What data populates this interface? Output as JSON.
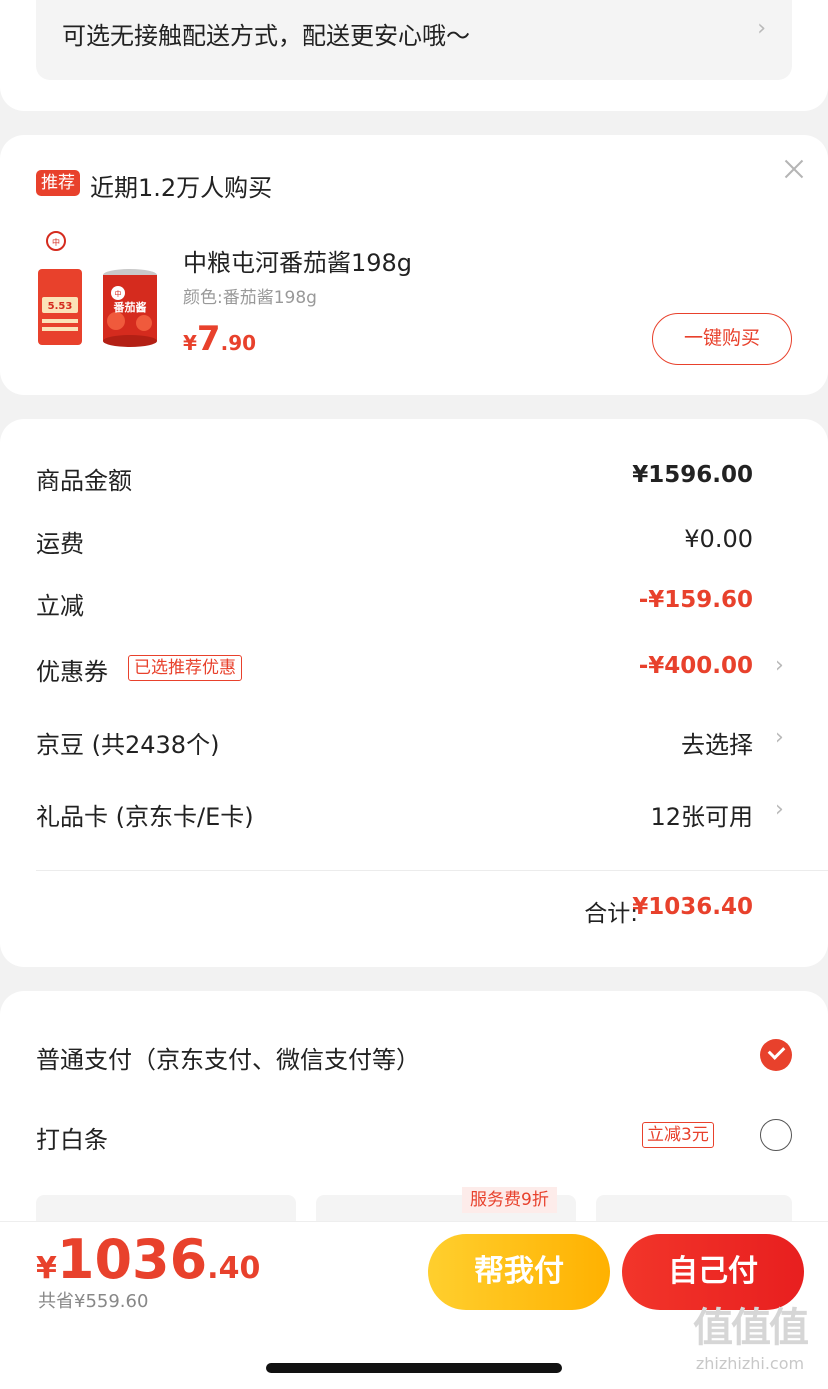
{
  "delivery": {
    "text": "可选无接触配送方式，配送更安心哦～"
  },
  "recommend": {
    "badge": "推荐",
    "title": "近期1.2万人购买",
    "product": {
      "name": "中粮屯河番茄酱198g",
      "spec": "颜色:番茄酱198g",
      "currency": "¥",
      "price_int": "7",
      "price_dec": ".90",
      "buy_label": "一键购买",
      "image_label": "番茄酱",
      "image_price": "5.53"
    }
  },
  "summary": {
    "rows": [
      {
        "label": "商品金额",
        "value": "¥1596.00"
      },
      {
        "label": "运费",
        "value": "¥0.00"
      },
      {
        "label": "立减",
        "value": "-¥159.60"
      },
      {
        "label": "优惠券",
        "value": "-¥400.00",
        "tag": "已选推荐优惠"
      },
      {
        "label": "京豆 (共2438个)",
        "value": "去选择"
      },
      {
        "label": "礼品卡 (京东卡/E卡)",
        "value": "12张可用"
      }
    ],
    "total_label": "合计:",
    "total_value": "¥1036.40"
  },
  "payment": {
    "options": [
      {
        "label": "普通支付（京东支付、微信支付等）",
        "selected": true
      },
      {
        "label": "打白条",
        "selected": false,
        "tag": "立减3元"
      }
    ],
    "plan_tag": "服务费9折"
  },
  "bottom": {
    "currency": "¥",
    "price_int": "1036",
    "price_dec": ".40",
    "saved": "共省¥559.60",
    "help_pay": "帮我付",
    "self_pay": "自己付"
  },
  "watermark": {
    "logo": "值值值",
    "text": "zhizhizhi.com"
  },
  "colors": {
    "accent": "#e8412c",
    "help_button": "#ffb100",
    "self_button": "#e81f1f"
  }
}
